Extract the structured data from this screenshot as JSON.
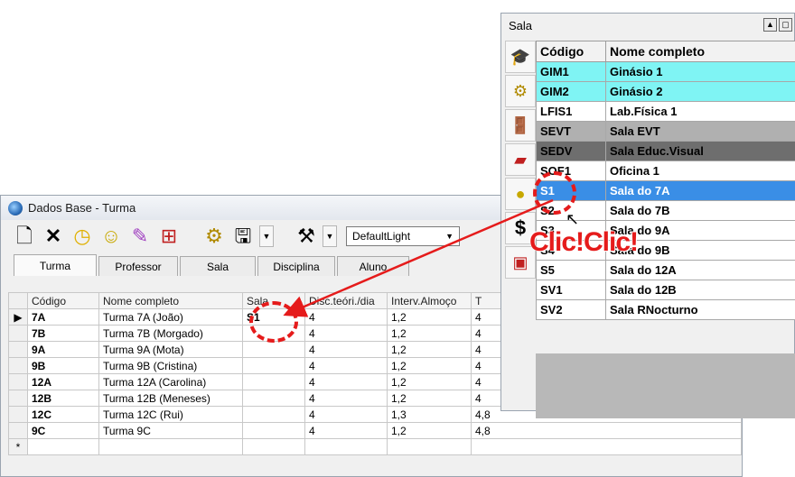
{
  "turma_window": {
    "title": "Dados Base - Turma",
    "toolbar_icons": [
      "new-document-icon",
      "delete-icon",
      "clock-icon",
      "people-icon",
      "paint-icon",
      "grid-icon",
      "gears-icon",
      "save-icon",
      "tools-icon"
    ],
    "theme_select": "DefaultLight",
    "tabs": [
      "Turma",
      "Professor",
      "Sala",
      "Disciplina",
      "Aluno"
    ],
    "columns": [
      "Código",
      "Nome completo",
      "Sala",
      "Disc.teóri./dia",
      "Interv.Almoço",
      "T"
    ],
    "rows": [
      {
        "indicator": "▶",
        "codigo": "7A",
        "nome": "Turma 7A (João)",
        "sala": "S1",
        "disc": "4",
        "interv": "1,2",
        "t": "4"
      },
      {
        "indicator": "",
        "codigo": "7B",
        "nome": "Turma 7B (Morgado)",
        "sala": "",
        "disc": "4",
        "interv": "1,2",
        "t": "4"
      },
      {
        "indicator": "",
        "codigo": "9A",
        "nome": "Turma 9A (Mota)",
        "sala": "",
        "disc": "4",
        "interv": "1,2",
        "t": "4"
      },
      {
        "indicator": "",
        "codigo": "9B",
        "nome": "Turma 9B (Cristina)",
        "sala": "",
        "disc": "4",
        "interv": "1,2",
        "t": "4"
      },
      {
        "indicator": "",
        "codigo": "12A",
        "nome": "Turma 12A (Carolina)",
        "sala": "",
        "disc": "4",
        "interv": "1,2",
        "t": "4"
      },
      {
        "indicator": "",
        "codigo": "12B",
        "nome": "Turma 12B (Meneses)",
        "sala": "",
        "disc": "4",
        "interv": "1,2",
        "t": "4"
      },
      {
        "indicator": "",
        "codigo": "12C",
        "nome": "Turma 12C (Rui)",
        "sala": "",
        "disc": "4",
        "interv": "1,3",
        "t": "4,8"
      },
      {
        "indicator": "",
        "codigo": "9C",
        "nome": "Turma 9C",
        "sala": "",
        "disc": "4",
        "interv": "1,2",
        "t": "4,8"
      },
      {
        "indicator": "*",
        "codigo": "",
        "nome": "",
        "sala": "",
        "disc": "",
        "interv": "",
        "t": ""
      }
    ]
  },
  "sala_window": {
    "title": "Sala",
    "columns": [
      "Código",
      "Nome completo"
    ],
    "rows": [
      {
        "codigo": "GIM1",
        "nome": "Ginásio 1",
        "bg": "#7ff4f4",
        "fg": "#000000"
      },
      {
        "codigo": "GIM2",
        "nome": "Ginásio 2",
        "bg": "#7ff4f4",
        "fg": "#000000"
      },
      {
        "codigo": "LFIS1",
        "nome": "Lab.Física 1",
        "bg": "#ffffff",
        "fg": "#000000"
      },
      {
        "codigo": "SEVT",
        "nome": "Sala EVT",
        "bg": "#b0b0b0",
        "fg": "#000000"
      },
      {
        "codigo": "SEDV",
        "nome": "Sala Educ.Visual",
        "bg": "#6e6e6e",
        "fg": "#000000"
      },
      {
        "codigo": "SOF1",
        "nome": "Oficina 1",
        "bg": "#ffffff",
        "fg": "#000000"
      },
      {
        "codigo": "S1",
        "nome": "Sala do 7A",
        "bg": "#3a8ee6",
        "fg": "#ffffff"
      },
      {
        "codigo": "S2",
        "nome": "Sala do 7B",
        "bg": "#ffffff",
        "fg": "#000000"
      },
      {
        "codigo": "S3",
        "nome": "Sala do 9A",
        "bg": "#ffffff",
        "fg": "#000000"
      },
      {
        "codigo": "S4",
        "nome": "Sala do 9B",
        "bg": "#ffffff",
        "fg": "#000000"
      },
      {
        "codigo": "S5",
        "nome": "Sala do 12A",
        "bg": "#ffffff",
        "fg": "#000000"
      },
      {
        "codigo": "SV1",
        "nome": "Sala do 12B",
        "bg": "#ffffff",
        "fg": "#000000"
      },
      {
        "codigo": "SV2",
        "nome": "Sala RNocturno",
        "bg": "#ffffff",
        "fg": "#000000"
      }
    ],
    "sidebar_icons": [
      "graduation-cap-icon",
      "gears-icon",
      "door-icon",
      "eraser-icon",
      "coin-icon",
      "dollar-icon",
      "calendar-icon"
    ]
  },
  "annotation": {
    "clic_text": "Clic!Clic!",
    "color": "#e51b1b"
  }
}
